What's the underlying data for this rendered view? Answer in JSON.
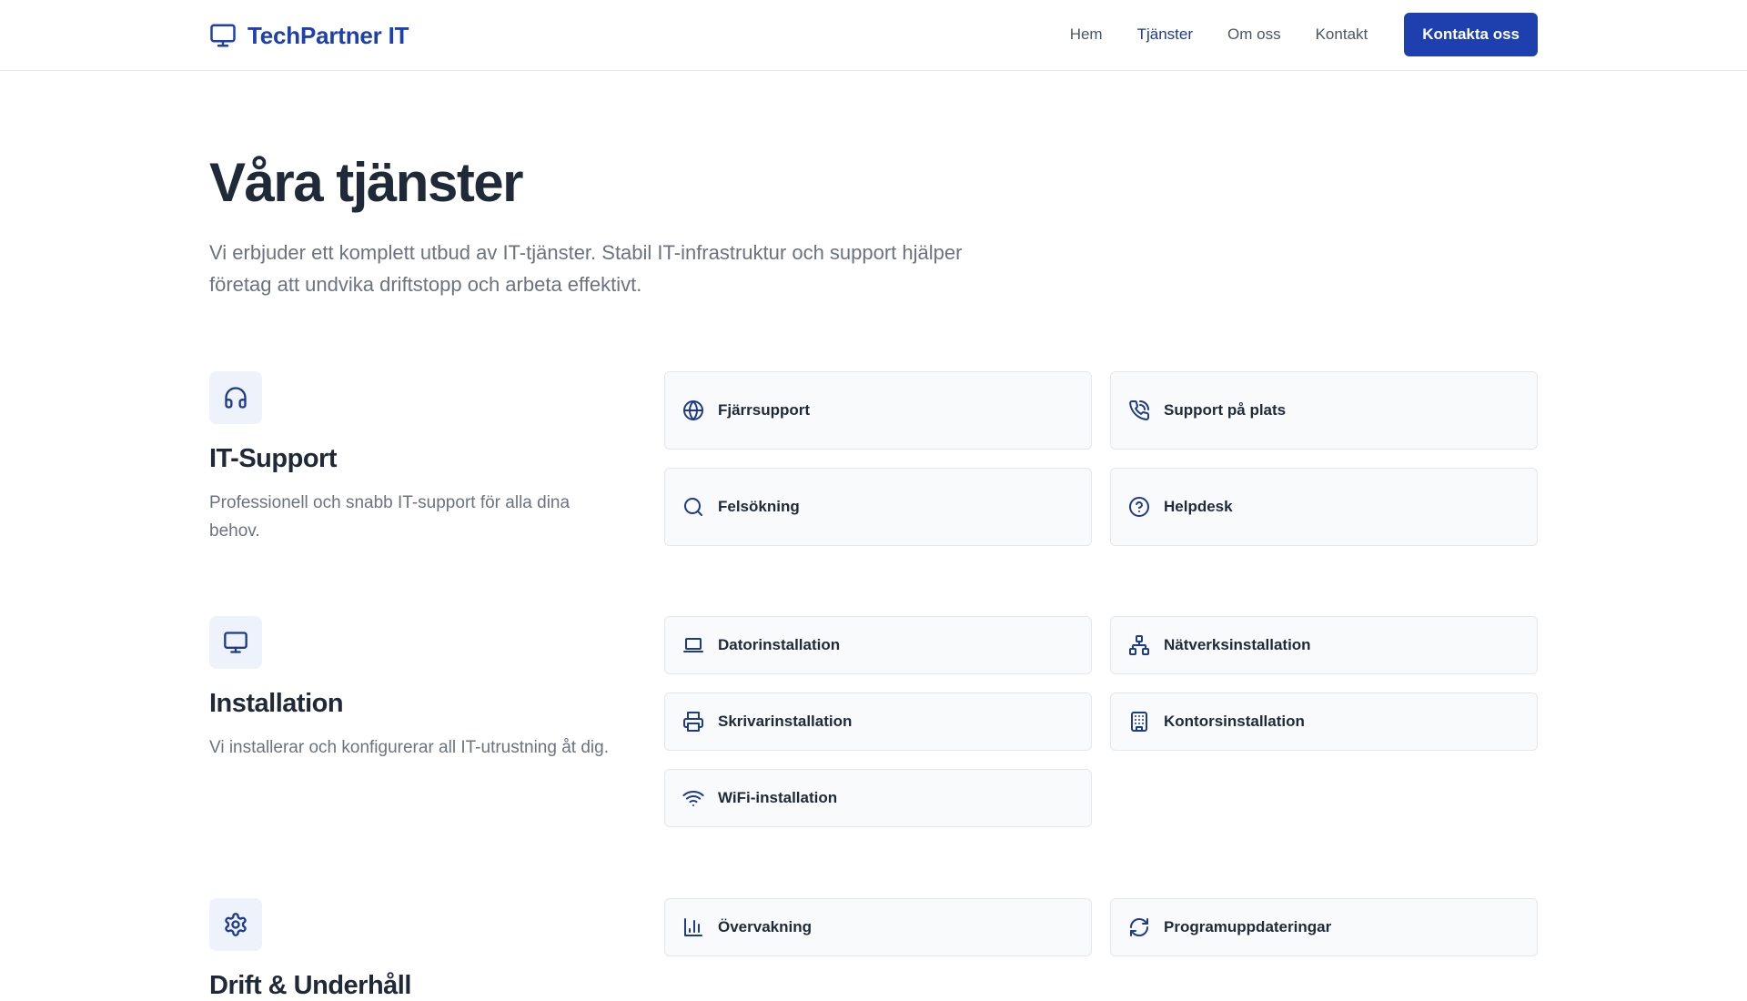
{
  "header": {
    "logo_text": "TechPartner IT",
    "nav": [
      "Hem",
      "Tjänster",
      "Om oss",
      "Kontakt"
    ],
    "cta_label": "Kontakta oss"
  },
  "page": {
    "title": "Våra tjänster",
    "intro": "Vi erbjuder ett komplett utbud av IT-tjänster. Stabil IT-infrastruktur och support hjälper företag att undvika driftstopp och arbeta effektivt."
  },
  "sections": [
    {
      "icon": "headphones-icon",
      "title": "IT-Support",
      "description": "Professionell och snabb IT-support för alla dina behov.",
      "items": [
        {
          "label": "Fjärrsupport",
          "icon": "globe-icon"
        },
        {
          "label": "Support på plats",
          "icon": "phone-icon"
        },
        {
          "label": "Felsökning",
          "icon": "search-icon"
        },
        {
          "label": "Helpdesk",
          "icon": "help-circle-icon"
        }
      ]
    },
    {
      "icon": "monitor-icon",
      "title": "Installation",
      "description": "Vi installerar och konfigurerar all IT-utrustning åt dig.",
      "items": [
        {
          "label": "Datorinstallation",
          "icon": "laptop-icon"
        },
        {
          "label": "Nätverksinstallation",
          "icon": "network-icon"
        },
        {
          "label": "Skrivarinstallation",
          "icon": "printer-icon"
        },
        {
          "label": "Kontorsinstallation",
          "icon": "building-icon"
        },
        {
          "label": "WiFi-installation",
          "icon": "wifi-icon"
        }
      ]
    },
    {
      "icon": "gear-icon",
      "title": "Drift & Underhåll",
      "items": [
        {
          "label": "Övervakning",
          "icon": "bar-chart-icon"
        },
        {
          "label": "Programuppdateringar",
          "icon": "refresh-icon"
        }
      ]
    }
  ],
  "colors": {
    "accent": "#1e40af",
    "heading": "#1f2937",
    "muted": "#6b7280",
    "card_bg": "#f9fafb",
    "border": "#e5e7eb",
    "icon_bg": "#eef2fb"
  }
}
